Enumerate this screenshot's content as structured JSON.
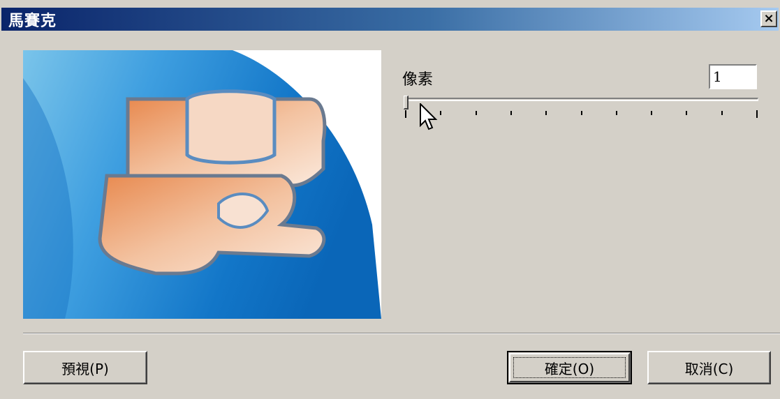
{
  "window": {
    "title": "馬賽克",
    "close_label": "×"
  },
  "controls": {
    "pixel_label": "像素",
    "pixel_value": "1",
    "slider": {
      "min": 1,
      "max": 11,
      "value": 1
    }
  },
  "buttons": {
    "preview_label": "預視(P)",
    "ok_label": "確定(O)",
    "cancel_label": "取消(C)"
  },
  "icons": {
    "preview_image": "mosaic-preview-image",
    "cursor": "mouse-pointer-icon"
  }
}
